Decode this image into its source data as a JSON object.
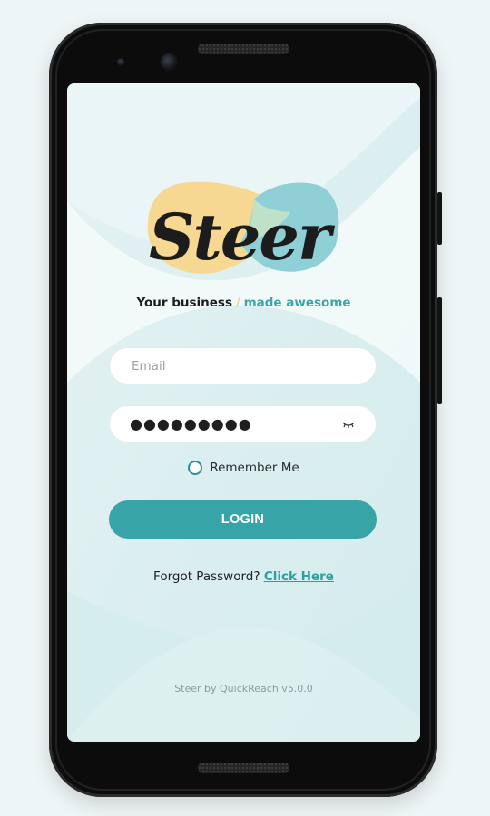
{
  "app": {
    "name": "Steer",
    "logo_text": "Steer",
    "tagline_left": "Your business",
    "tagline_sep": "/",
    "tagline_right": "made awesome"
  },
  "form": {
    "email_placeholder": "Email",
    "email_value": "",
    "password_masked": "●●●●●●●●●",
    "remember_label": "Remember Me",
    "remember_checked": false,
    "login_label": "LOGIN"
  },
  "footer": {
    "forgot_text": "Forgot Password?",
    "forgot_link": "Click Here",
    "version": "Steer by QuickReach v5.0.0"
  },
  "icons": {
    "password_toggle": "eye-closed-icon"
  },
  "colors": {
    "accent": "#37a4a7",
    "logo_yellow": "#f7d892",
    "logo_teal": "#8fd0d6",
    "background": "#def0f1"
  }
}
